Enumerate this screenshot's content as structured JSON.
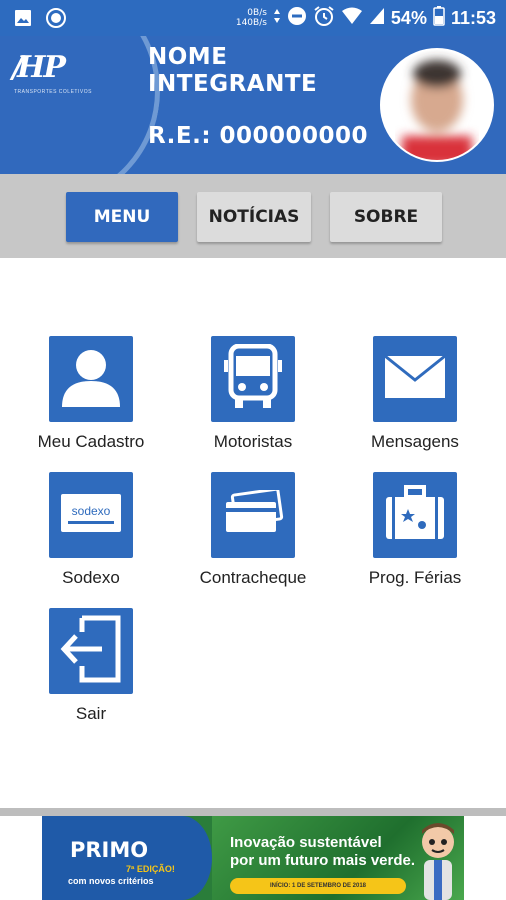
{
  "status_bar": {
    "speed_up": "0B/s",
    "speed_down": "140B/s",
    "battery": "54%",
    "time": "11:53"
  },
  "header": {
    "logo_text": "HP",
    "logo_subtitle": "TRANSPORTES COLETIVOS",
    "name_line1": "NOME",
    "name_line2": "INTEGRANTE",
    "re": "R.E.: 000000000"
  },
  "tabs": [
    {
      "label": "MENU",
      "active": true
    },
    {
      "label": "NOTÍCIAS",
      "active": false
    },
    {
      "label": "SOBRE",
      "active": false
    }
  ],
  "menu": [
    {
      "label": "Meu Cadastro",
      "icon": "user-icon"
    },
    {
      "label": "Motoristas",
      "icon": "bus-icon"
    },
    {
      "label": "Mensagens",
      "icon": "envelope-icon"
    },
    {
      "label": "Sodexo",
      "icon": "sodexo-card-icon",
      "card_text": "sodexo"
    },
    {
      "label": "Contracheque",
      "icon": "cards-icon"
    },
    {
      "label": "Prog. Férias",
      "icon": "suitcase-icon"
    },
    {
      "label": "Sair",
      "icon": "exit-icon"
    }
  ],
  "ad": {
    "brand": "PRIMO",
    "edition": "7ª EDIÇÃO!",
    "criteria": "com novos critérios",
    "headline_line1": "Inovação sustentável",
    "headline_line2": "por um futuro mais verde.",
    "start": "INÍCIO: 1 DE SETEMBRO DE 2018"
  },
  "colors": {
    "primary": "#3169bd",
    "tab_bar": "#c7c7c7",
    "tab_inactive": "#dcdcdc"
  }
}
